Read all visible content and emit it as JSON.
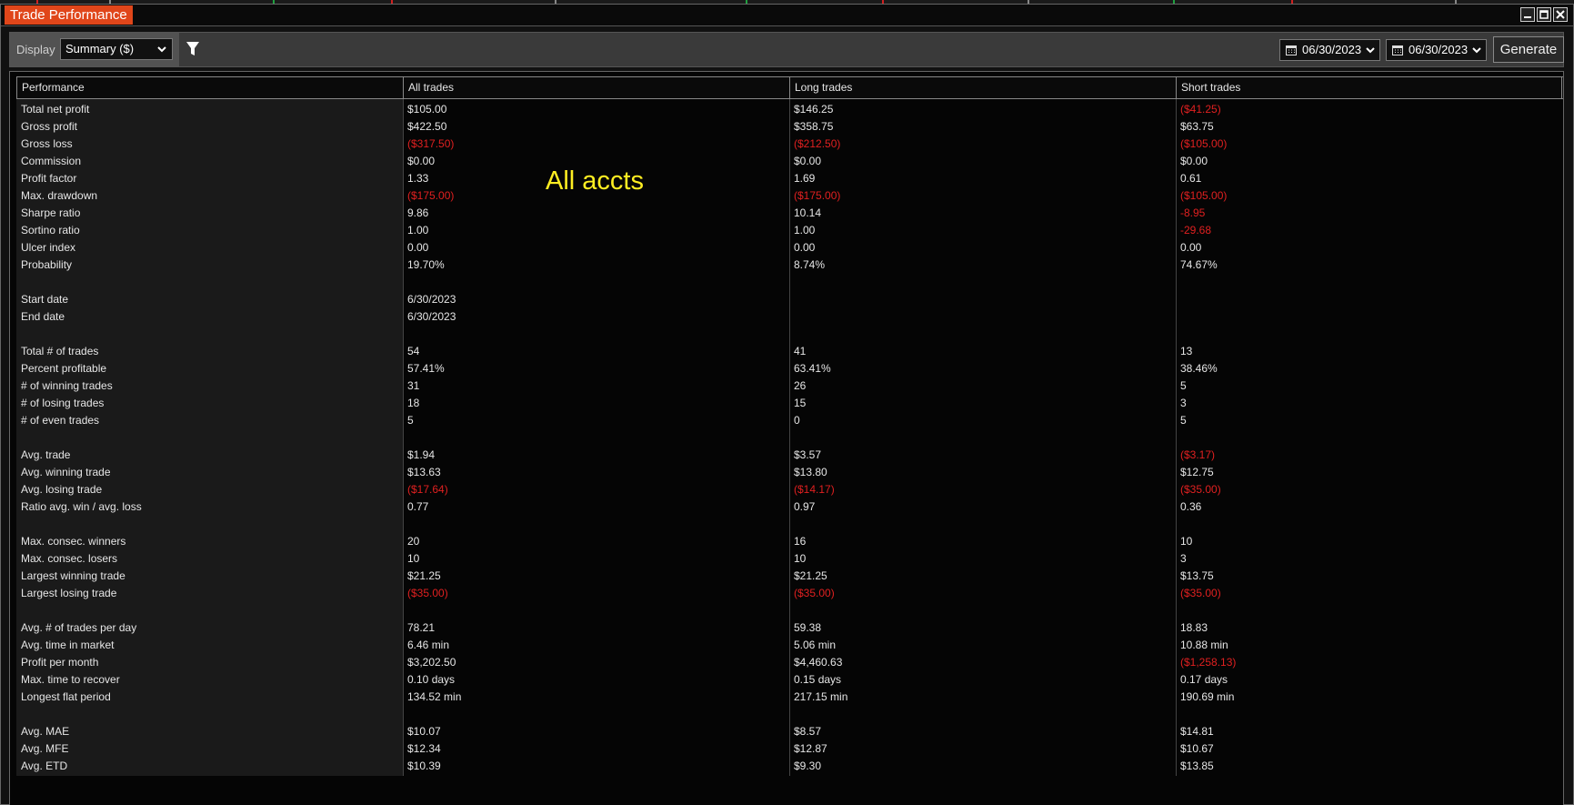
{
  "window": {
    "title": "Trade Performance"
  },
  "toolbar": {
    "display_label": "Display",
    "display_value": "Summary ($)",
    "date_from": "06/30/2023",
    "date_to": "06/30/2023",
    "generate_label": "Generate"
  },
  "overlay_text": "All accts",
  "colors": {
    "accent": "#e0461a",
    "negative": "#e02020",
    "overlay": "#ffee22"
  },
  "table": {
    "headers": [
      "Performance",
      "All trades",
      "Long trades",
      "Short trades"
    ],
    "rows": [
      {
        "label": "Total net profit",
        "all": "$105.00",
        "long": "$146.25",
        "short": "($41.25)",
        "neg": [
          false,
          false,
          true
        ]
      },
      {
        "label": "Gross profit",
        "all": "$422.50",
        "long": "$358.75",
        "short": "$63.75",
        "neg": [
          false,
          false,
          false
        ]
      },
      {
        "label": "Gross loss",
        "all": "($317.50)",
        "long": "($212.50)",
        "short": "($105.00)",
        "neg": [
          true,
          true,
          true
        ]
      },
      {
        "label": "Commission",
        "all": "$0.00",
        "long": "$0.00",
        "short": "$0.00",
        "neg": [
          false,
          false,
          false
        ]
      },
      {
        "label": "Profit factor",
        "all": "1.33",
        "long": "1.69",
        "short": "0.61",
        "neg": [
          false,
          false,
          false
        ]
      },
      {
        "label": "Max. drawdown",
        "all": "($175.00)",
        "long": "($175.00)",
        "short": "($105.00)",
        "neg": [
          true,
          true,
          true
        ]
      },
      {
        "label": "Sharpe ratio",
        "all": "9.86",
        "long": "10.14",
        "short": "-8.95",
        "neg": [
          false,
          false,
          true
        ]
      },
      {
        "label": "Sortino ratio",
        "all": "1.00",
        "long": "1.00",
        "short": "-29.68",
        "neg": [
          false,
          false,
          true
        ]
      },
      {
        "label": "Ulcer index",
        "all": "0.00",
        "long": "0.00",
        "short": "0.00",
        "neg": [
          false,
          false,
          false
        ]
      },
      {
        "label": "Probability",
        "all": "19.70%",
        "long": "8.74%",
        "short": "74.67%",
        "neg": [
          false,
          false,
          false
        ]
      },
      {
        "label": "",
        "all": "",
        "long": "",
        "short": "",
        "neg": [
          false,
          false,
          false
        ]
      },
      {
        "label": "Start date",
        "all": "6/30/2023",
        "long": "",
        "short": "",
        "neg": [
          false,
          false,
          false
        ]
      },
      {
        "label": "End date",
        "all": "6/30/2023",
        "long": "",
        "short": "",
        "neg": [
          false,
          false,
          false
        ]
      },
      {
        "label": "",
        "all": "",
        "long": "",
        "short": "",
        "neg": [
          false,
          false,
          false
        ]
      },
      {
        "label": "Total # of trades",
        "all": "54",
        "long": "41",
        "short": "13",
        "neg": [
          false,
          false,
          false
        ]
      },
      {
        "label": "Percent profitable",
        "all": "57.41%",
        "long": "63.41%",
        "short": "38.46%",
        "neg": [
          false,
          false,
          false
        ]
      },
      {
        "label": "# of winning trades",
        "all": "31",
        "long": "26",
        "short": "5",
        "neg": [
          false,
          false,
          false
        ]
      },
      {
        "label": "# of losing trades",
        "all": "18",
        "long": "15",
        "short": "3",
        "neg": [
          false,
          false,
          false
        ]
      },
      {
        "label": "# of even trades",
        "all": "5",
        "long": "0",
        "short": "5",
        "neg": [
          false,
          false,
          false
        ]
      },
      {
        "label": "",
        "all": "",
        "long": "",
        "short": "",
        "neg": [
          false,
          false,
          false
        ]
      },
      {
        "label": "Avg. trade",
        "all": "$1.94",
        "long": "$3.57",
        "short": "($3.17)",
        "neg": [
          false,
          false,
          true
        ]
      },
      {
        "label": "Avg. winning trade",
        "all": "$13.63",
        "long": "$13.80",
        "short": "$12.75",
        "neg": [
          false,
          false,
          false
        ]
      },
      {
        "label": "Avg. losing trade",
        "all": "($17.64)",
        "long": "($14.17)",
        "short": "($35.00)",
        "neg": [
          true,
          true,
          true
        ]
      },
      {
        "label": "Ratio avg. win / avg. loss",
        "all": "0.77",
        "long": "0.97",
        "short": "0.36",
        "neg": [
          false,
          false,
          false
        ]
      },
      {
        "label": "",
        "all": "",
        "long": "",
        "short": "",
        "neg": [
          false,
          false,
          false
        ]
      },
      {
        "label": "Max. consec. winners",
        "all": "20",
        "long": "16",
        "short": "10",
        "neg": [
          false,
          false,
          false
        ]
      },
      {
        "label": "Max. consec. losers",
        "all": "10",
        "long": "10",
        "short": "3",
        "neg": [
          false,
          false,
          false
        ]
      },
      {
        "label": "Largest winning trade",
        "all": "$21.25",
        "long": "$21.25",
        "short": "$13.75",
        "neg": [
          false,
          false,
          false
        ]
      },
      {
        "label": "Largest losing trade",
        "all": "($35.00)",
        "long": "($35.00)",
        "short": "($35.00)",
        "neg": [
          true,
          true,
          true
        ]
      },
      {
        "label": "",
        "all": "",
        "long": "",
        "short": "",
        "neg": [
          false,
          false,
          false
        ]
      },
      {
        "label": "Avg. # of trades per day",
        "all": "78.21",
        "long": "59.38",
        "short": "18.83",
        "neg": [
          false,
          false,
          false
        ]
      },
      {
        "label": "Avg. time in market",
        "all": "6.46 min",
        "long": "5.06 min",
        "short": "10.88 min",
        "neg": [
          false,
          false,
          false
        ]
      },
      {
        "label": "Profit per month",
        "all": "$3,202.50",
        "long": "$4,460.63",
        "short": "($1,258.13)",
        "neg": [
          false,
          false,
          true
        ]
      },
      {
        "label": "Max. time to recover",
        "all": "0.10 days",
        "long": "0.15 days",
        "short": "0.17 days",
        "neg": [
          false,
          false,
          false
        ]
      },
      {
        "label": "Longest flat period",
        "all": "134.52 min",
        "long": "217.15 min",
        "short": "190.69 min",
        "neg": [
          false,
          false,
          false
        ]
      },
      {
        "label": "",
        "all": "",
        "long": "",
        "short": "",
        "neg": [
          false,
          false,
          false
        ]
      },
      {
        "label": "Avg. MAE",
        "all": "$10.07",
        "long": "$8.57",
        "short": "$14.81",
        "neg": [
          false,
          false,
          false
        ]
      },
      {
        "label": "Avg. MFE",
        "all": "$12.34",
        "long": "$12.87",
        "short": "$10.67",
        "neg": [
          false,
          false,
          false
        ]
      },
      {
        "label": "Avg. ETD",
        "all": "$10.39",
        "long": "$9.30",
        "short": "$13.85",
        "neg": [
          false,
          false,
          false
        ]
      }
    ]
  }
}
